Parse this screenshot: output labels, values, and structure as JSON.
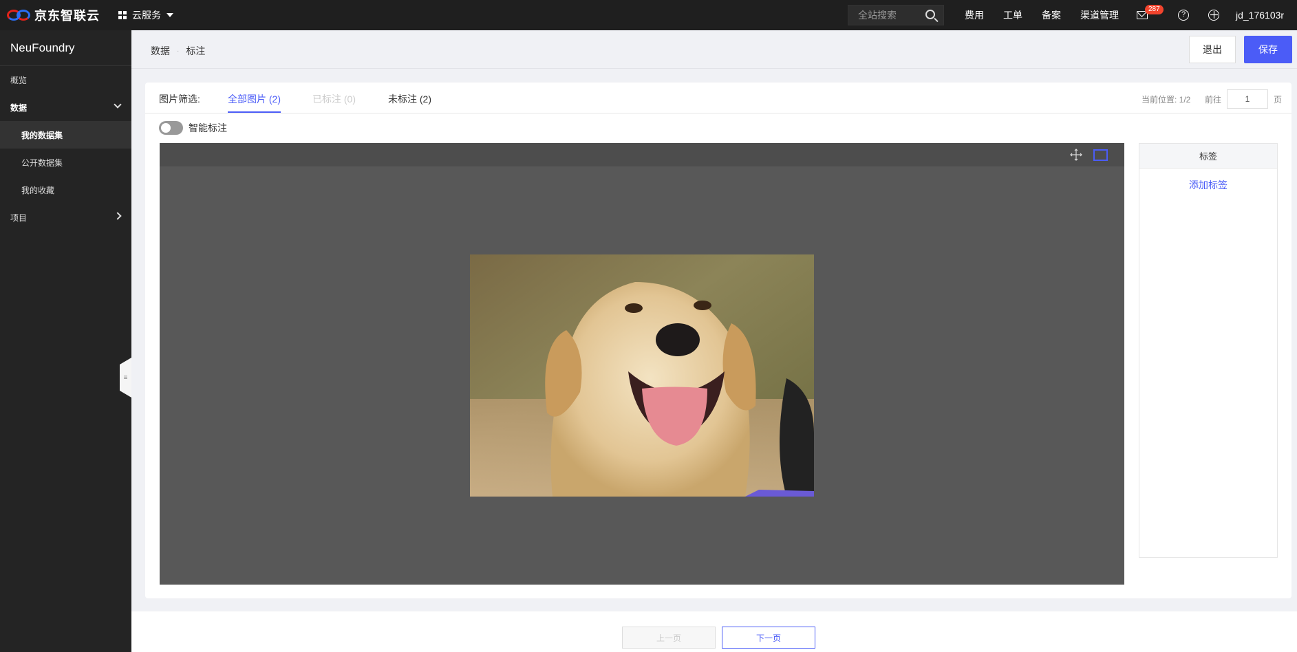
{
  "topbar": {
    "brand": "京东智联云",
    "cloud_service": "云服务",
    "search_placeholder": "全站搜索",
    "links": [
      "费用",
      "工单",
      "备案",
      "渠道管理"
    ],
    "mail_count": "287",
    "help_glyph": "?",
    "username": "jd_176103r"
  },
  "sidebar": {
    "title": "NeuFoundry",
    "items": [
      {
        "label": "概览"
      },
      {
        "label": "数据"
      },
      {
        "label": "我的数据集"
      },
      {
        "label": "公开数据集"
      },
      {
        "label": "我的收藏"
      },
      {
        "label": "项目"
      }
    ]
  },
  "breadcrumb": {
    "items": [
      "数据",
      "标注"
    ],
    "separator": "·"
  },
  "actions": {
    "exit": "退出",
    "save": "保存"
  },
  "filter": {
    "label": "图片筛选:",
    "tabs": [
      "全部图片 (2)",
      "已标注 (0)",
      "未标注 (2)"
    ],
    "position_text": "当前位置: 1/2",
    "goto_label": "前往",
    "goto_value": "1",
    "page_unit": "页"
  },
  "smart_label": {
    "label": "智能标注",
    "enabled": false
  },
  "label_panel": {
    "header": "标签",
    "add": "添加标签"
  },
  "pager": {
    "prev": "上一页",
    "next": "下一页"
  },
  "colors": {
    "accent": "#4b5cf7",
    "topbar": "#1f1f1f",
    "sidebar": "#242424",
    "badge": "#f2442d"
  }
}
